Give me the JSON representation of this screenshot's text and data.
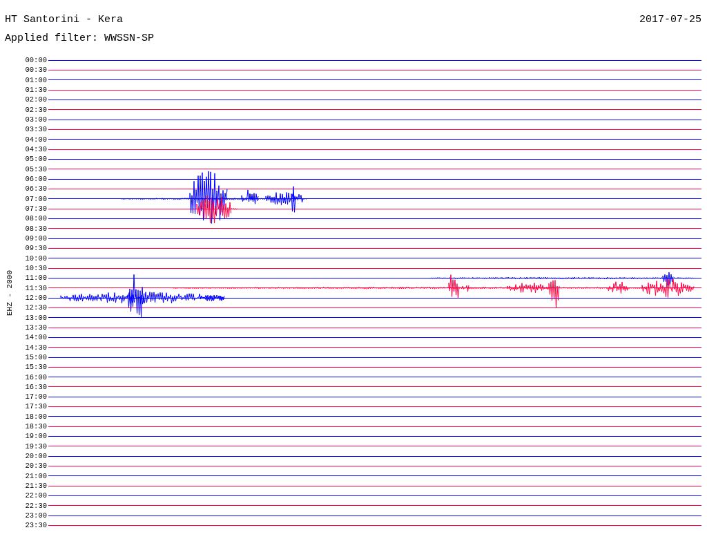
{
  "title": "HT Santorini - Kera",
  "date": "2017-07-25",
  "filter": "Applied filter: WWSSN-SP",
  "channel_label": "EHZ - 2000",
  "rows": [
    {
      "time": "00:00",
      "color": "#0000ff"
    },
    {
      "time": "00:30",
      "color": "#ff0040"
    },
    {
      "time": "01:00",
      "color": "#0000ff"
    },
    {
      "time": "01:30",
      "color": "#ff0040"
    },
    {
      "time": "02:00",
      "color": "#0000ff"
    },
    {
      "time": "02:30",
      "color": "#ff0040"
    },
    {
      "time": "03:00",
      "color": "#0000ff"
    },
    {
      "time": "03:30",
      "color": "#ff0040"
    },
    {
      "time": "04:00",
      "color": "#0000ff"
    },
    {
      "time": "04:30",
      "color": "#ff0040"
    },
    {
      "time": "05:00",
      "color": "#0000ff"
    },
    {
      "time": "05:30",
      "color": "#ff0040"
    },
    {
      "time": "06:00",
      "color": "#0000ff"
    },
    {
      "time": "06:30",
      "color": "#ff0040"
    },
    {
      "time": "07:00",
      "color": "#0000ff"
    },
    {
      "time": "07:30",
      "color": "#ff0040"
    },
    {
      "time": "08:00",
      "color": "#0000ff"
    },
    {
      "time": "08:30",
      "color": "#ff0040"
    },
    {
      "time": "09:00",
      "color": "#0000ff"
    },
    {
      "time": "09:30",
      "color": "#ff0040"
    },
    {
      "time": "10:00",
      "color": "#0000ff"
    },
    {
      "time": "10:30",
      "color": "#ff0040"
    },
    {
      "time": "11:00",
      "color": "#0000ff"
    },
    {
      "time": "11:30",
      "color": "#ff0040"
    },
    {
      "time": "12:00",
      "color": "#0000ff"
    },
    {
      "time": "12:30",
      "color": "#ff0040"
    },
    {
      "time": "13:00",
      "color": "#0000ff"
    },
    {
      "time": "13:30",
      "color": "#ff0040"
    },
    {
      "time": "14:00",
      "color": "#0000ff"
    },
    {
      "time": "14:30",
      "color": "#ff0040"
    },
    {
      "time": "15:00",
      "color": "#0000ff"
    },
    {
      "time": "15:30",
      "color": "#ff0040"
    },
    {
      "time": "16:00",
      "color": "#0000ff"
    },
    {
      "time": "16:30",
      "color": "#ff0040"
    },
    {
      "time": "17:00",
      "color": "#0000ff"
    },
    {
      "time": "17:30",
      "color": "#ff0040"
    },
    {
      "time": "18:00",
      "color": "#0000ff"
    },
    {
      "time": "18:30",
      "color": "#ff0040"
    },
    {
      "time": "19:00",
      "color": "#0000ff"
    },
    {
      "time": "19:30",
      "color": "#ff0040"
    },
    {
      "time": "20:00",
      "color": "#0000ff"
    },
    {
      "time": "20:30",
      "color": "#ff0040"
    },
    {
      "time": "21:00",
      "color": "#0000ff"
    },
    {
      "time": "21:30",
      "color": "#ff0040"
    },
    {
      "time": "22:00",
      "color": "#0000ff"
    },
    {
      "time": "22:30",
      "color": "#ff0040"
    },
    {
      "time": "23:00",
      "color": "#0000ff"
    },
    {
      "time": "23:30",
      "color": "#ff0040"
    }
  ]
}
